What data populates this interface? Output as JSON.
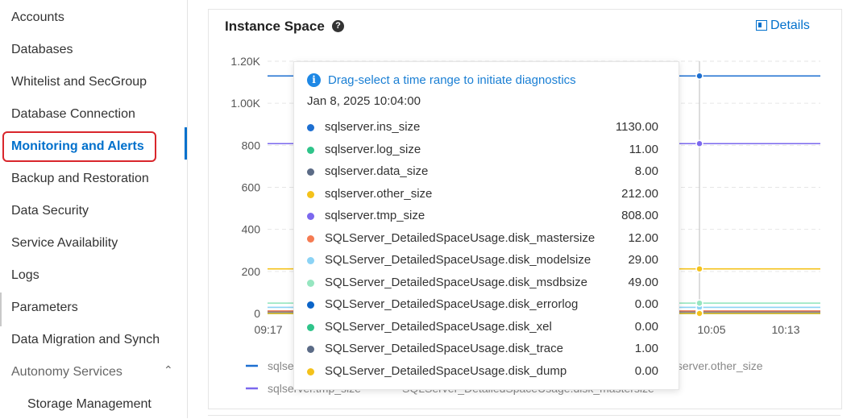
{
  "sidebar": {
    "items": [
      {
        "label": "Accounts"
      },
      {
        "label": "Databases"
      },
      {
        "label": "Whitelist and SecGroup"
      },
      {
        "label": "Database Connection"
      },
      {
        "label": "Monitoring and Alerts"
      },
      {
        "label": "Backup and Restoration"
      },
      {
        "label": "Data Security"
      },
      {
        "label": "Service Availability"
      },
      {
        "label": "Logs"
      },
      {
        "label": "Parameters"
      },
      {
        "label": "Data Migration and Synch"
      },
      {
        "label": "Autonomy Services"
      },
      {
        "label": "Storage Management"
      }
    ]
  },
  "panel": {
    "title": "Instance Space",
    "details_label": "Details",
    "help_icon": "question-icon"
  },
  "chart_data": {
    "type": "line",
    "y_ticks": [
      "1.20K",
      "1.00K",
      "800",
      "600",
      "400",
      "200",
      "0"
    ],
    "x_ticks": [
      "09:17",
      "10:05",
      "10:13"
    ],
    "ylim": [
      0,
      1200
    ],
    "series": [
      {
        "name": "sqlserver.ins_size",
        "color": "#1d6fd1",
        "value": 1130
      },
      {
        "name": "sqlserver.log_size",
        "color": "#2fc48a",
        "value": 11
      },
      {
        "name": "sqlserver.data_size",
        "color": "#5b6b86",
        "value": 8
      },
      {
        "name": "sqlserver.other_size",
        "color": "#f4c21b",
        "value": 212
      },
      {
        "name": "sqlserver.tmp_size",
        "color": "#7b68ee",
        "value": 808
      },
      {
        "name": "SQLServer_DetailedSpaceUsage.disk_mastersize",
        "color": "#f57b52",
        "value": 12
      },
      {
        "name": "SQLServer_DetailedSpaceUsage.disk_modelsize",
        "color": "#8bd3f5",
        "value": 29
      },
      {
        "name": "SQLServer_DetailedSpaceUsage.disk_msdbsize",
        "color": "#96e6c0",
        "value": 49
      },
      {
        "name": "SQLServer_DetailedSpaceUsage.disk_errorlog",
        "color": "#0b64c8",
        "value": 0
      },
      {
        "name": "SQLServer_DetailedSpaceUsage.disk_xel",
        "color": "#2fc48a",
        "value": 0
      },
      {
        "name": "SQLServer_DetailedSpaceUsage.disk_trace",
        "color": "#5b6b86",
        "value": 1
      },
      {
        "name": "SQLServer_DetailedSpaceUsage.disk_dump",
        "color": "#f4c21b",
        "value": 0
      }
    ],
    "legend": [
      {
        "label": "sqlserver.ins_size",
        "color": "#1d6fd1"
      },
      {
        "label": "sqlserver.other_size",
        "color": "#f4c21b"
      },
      {
        "label": "sqlserver.tmp_size",
        "color": "#7b68ee"
      },
      {
        "label": "SQLServer_DetailedSpaceUsage.disk_mastersize",
        "color": "#f57b52"
      }
    ]
  },
  "tooltip": {
    "message": "Drag-select a time range to initiate diagnostics",
    "time": "Jan 8, 2025 10:04:00",
    "rows": [
      {
        "name": "sqlserver.ins_size",
        "value": "1130.00",
        "color": "#1d6fd1"
      },
      {
        "name": "sqlserver.log_size",
        "value": "11.00",
        "color": "#2fc48a"
      },
      {
        "name": "sqlserver.data_size",
        "value": "8.00",
        "color": "#5b6b86"
      },
      {
        "name": "sqlserver.other_size",
        "value": "212.00",
        "color": "#f4c21b"
      },
      {
        "name": "sqlserver.tmp_size",
        "value": "808.00",
        "color": "#7b68ee"
      },
      {
        "name": "SQLServer_DetailedSpaceUsage.disk_mastersize",
        "value": "12.00",
        "color": "#f57b52"
      },
      {
        "name": "SQLServer_DetailedSpaceUsage.disk_modelsize",
        "value": "29.00",
        "color": "#8bd3f5"
      },
      {
        "name": "SQLServer_DetailedSpaceUsage.disk_msdbsize",
        "value": "49.00",
        "color": "#96e6c0"
      },
      {
        "name": "SQLServer_DetailedSpaceUsage.disk_errorlog",
        "value": "0.00",
        "color": "#0b64c8"
      },
      {
        "name": "SQLServer_DetailedSpaceUsage.disk_xel",
        "value": "0.00",
        "color": "#2fc48a"
      },
      {
        "name": "SQLServer_DetailedSpaceUsage.disk_trace",
        "value": "1.00",
        "color": "#5b6b86"
      },
      {
        "name": "SQLServer_DetailedSpaceUsage.disk_dump",
        "value": "0.00",
        "color": "#f4c21b"
      }
    ]
  }
}
